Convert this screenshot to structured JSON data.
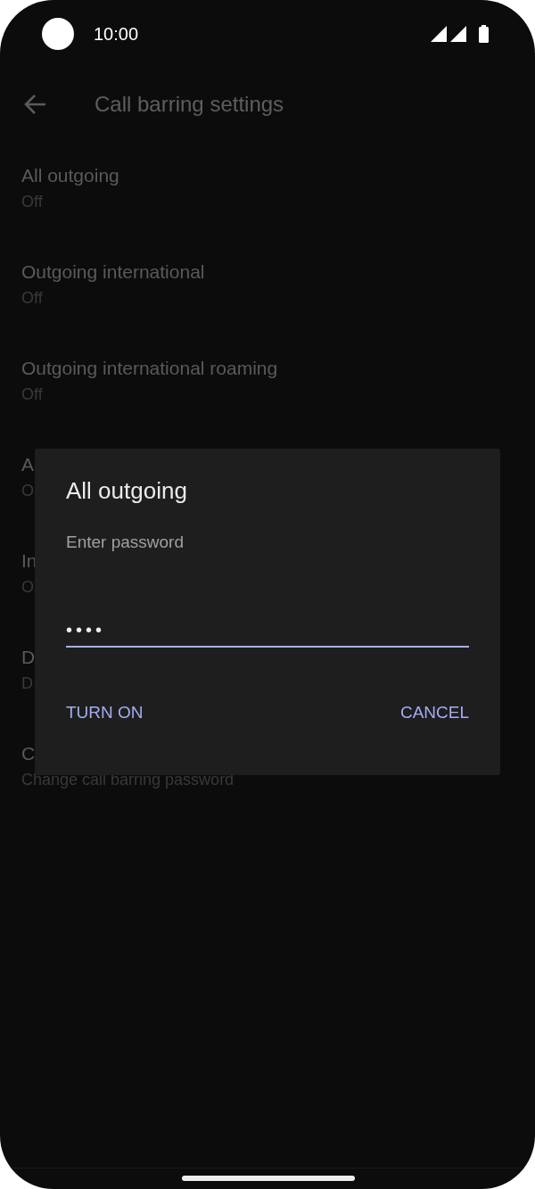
{
  "status_bar": {
    "time": "10:00"
  },
  "toolbar": {
    "title": "Call barring settings"
  },
  "settings": [
    {
      "title": "All outgoing",
      "summary": "Off"
    },
    {
      "title": "Outgoing international",
      "summary": "Off"
    },
    {
      "title": "Outgoing international roaming",
      "summary": "Off"
    },
    {
      "title": "A",
      "summary": "O"
    },
    {
      "title": "In",
      "summary": "O"
    },
    {
      "title": "D",
      "summary": "D"
    },
    {
      "title": "C",
      "summary": "Change call barring password"
    }
  ],
  "dialog": {
    "title": "All outgoing",
    "label": "Enter password",
    "value": "••••",
    "buttons": [
      "TURN ON",
      "CANCEL"
    ]
  }
}
